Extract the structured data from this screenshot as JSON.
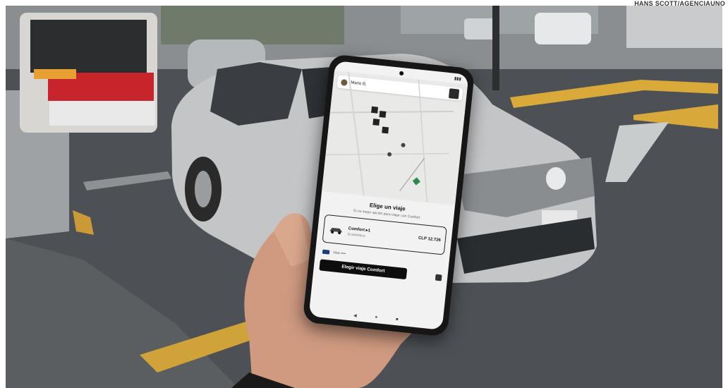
{
  "credit": "HANS SCOTT/AGENCIAUNO",
  "phone": {
    "status_time": "",
    "map_header": "Mario B.",
    "sheet_title": "Elige un viaje",
    "sheet_subtitle": "Es tu mejor opción para viajar con Comfort",
    "ride_name": "Comfort ▸1",
    "ride_meta": "Económico",
    "ride_price": "CLP 12.726",
    "payment_label": "Visa ••••",
    "cta_label": "Elegir viaje Comfort",
    "nav": {
      "back": "◀",
      "home": "●",
      "recents": "■"
    }
  },
  "colors": {
    "screen_bg": "#f2f2f2",
    "cta_bg": "#0d0d0d",
    "car_body": "#c4c6c8",
    "road": "#4c5054",
    "curb": "#d9a93a"
  },
  "icons": [
    "search-icon",
    "car-icon",
    "card-icon",
    "calendar-icon"
  ]
}
